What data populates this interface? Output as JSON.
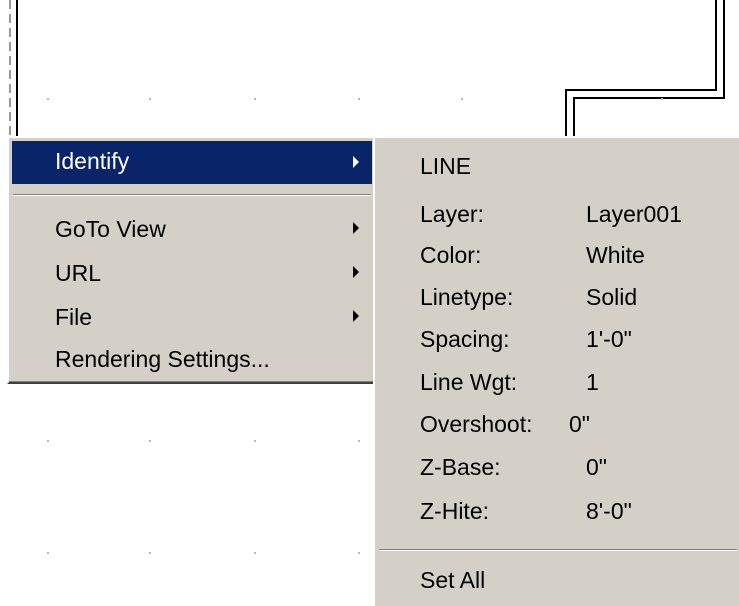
{
  "context_menu": {
    "items": [
      {
        "label": "Identify",
        "has_submenu": true,
        "selected": true
      },
      {
        "label": "GoTo View",
        "has_submenu": true
      },
      {
        "label": "URL",
        "has_submenu": true
      },
      {
        "label": "File",
        "has_submenu": true
      },
      {
        "label": "Rendering Settings...",
        "has_submenu": false
      }
    ]
  },
  "identify_submenu": {
    "header": "LINE",
    "properties": [
      {
        "key": "Layer:",
        "value": "Layer001"
      },
      {
        "key": "Color:",
        "value": "White"
      },
      {
        "key": "Linetype:",
        "value": "Solid"
      },
      {
        "key": "Spacing:",
        "value": "1'-0\""
      },
      {
        "key": "Line Wgt:",
        "value": "1"
      },
      {
        "key": "Overshoot:",
        "value": "0\""
      },
      {
        "key": "Z-Base:",
        "value": "0\""
      },
      {
        "key": "Z-Hite:",
        "value": "8'-0\""
      }
    ],
    "set_all": "Set All"
  },
  "colors": {
    "menu_bg": "#d4d0c8",
    "highlight": "#0a246a",
    "highlight_text": "#ffffff"
  }
}
